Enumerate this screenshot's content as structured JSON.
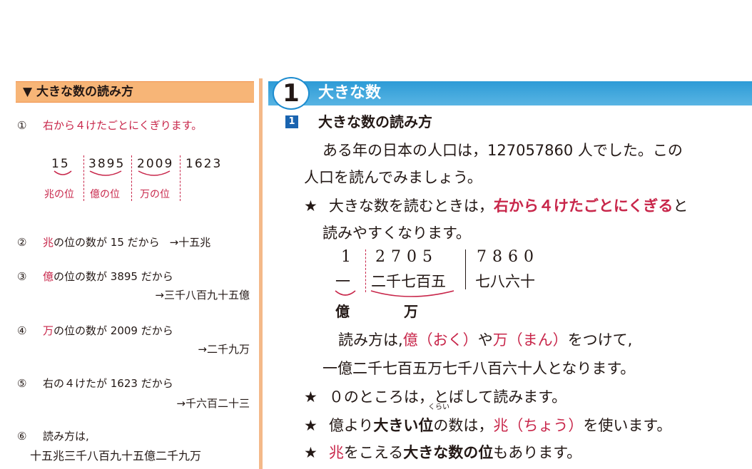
{
  "left": {
    "header": "▼ 大きな数の読み方",
    "step1": {
      "num": "①",
      "text": "右から４けたごとにくぎります。"
    },
    "groups": [
      {
        "digits": "15",
        "label": "兆の位"
      },
      {
        "digits": "3895",
        "label": "億の位"
      },
      {
        "digits": "2009",
        "label": "万の位"
      },
      {
        "digits": "1623",
        "label": ""
      }
    ],
    "step2": {
      "num": "②",
      "red": "兆",
      "text": "の位の数が 15 だから",
      "result": "→十五兆"
    },
    "step3": {
      "num": "③",
      "red": "億",
      "text": "の位の数が 3895 だから",
      "result": "→三千八百九十五億"
    },
    "step4": {
      "num": "④",
      "red": "万",
      "text": "の位の数が 2009 だから",
      "result": "→二千九万"
    },
    "step5": {
      "num": "⑤",
      "text": "右の４けたが 1623 だから",
      "result": "→千六百二十三"
    },
    "step6": {
      "num": "⑥",
      "text": "読み方は,",
      "result": "十五兆三千八百九十五億二千九万"
    }
  },
  "right": {
    "chapter_num": "1",
    "chapter_title": "大きな数",
    "section_num": "1",
    "section_title": "大きな数の読み方",
    "para1_line1": "ある年の日本の人口は，127057860 人でした。この",
    "para1_line2": "人口を読んでみましょう。",
    "star_symbol": "★",
    "star1_a": "大きな数を読むときは，",
    "star1_red": "右から４けたごとにくぎる",
    "star1_b": "と",
    "star1_line2": "読みやすくなります。",
    "ex_digits": [
      "1",
      "2705",
      "7860"
    ],
    "ex_kanji": [
      "一",
      "二千七百五",
      "七八六十"
    ],
    "ex_units": [
      "億",
      "万"
    ],
    "read_a": "読み方は,",
    "read_oku": "億（おく）",
    "read_ya": "や",
    "read_man": "万（まん）",
    "read_b": "をつけて,",
    "read_line2": "一億二千七百五万七千八百六十人となります。",
    "star2": "０のところは，とばして読みます。",
    "star3_a": "億より",
    "star3_bold": "大きい位",
    "star3_b": "の数は，",
    "star3_red": "兆（ちょう）",
    "star3_c": "を使います。",
    "ruby_kurai": "くらい",
    "star4_red": "兆",
    "star4_a": "をこえる",
    "star4_bold": "大きな数の位",
    "star4_b": "もあります。"
  }
}
